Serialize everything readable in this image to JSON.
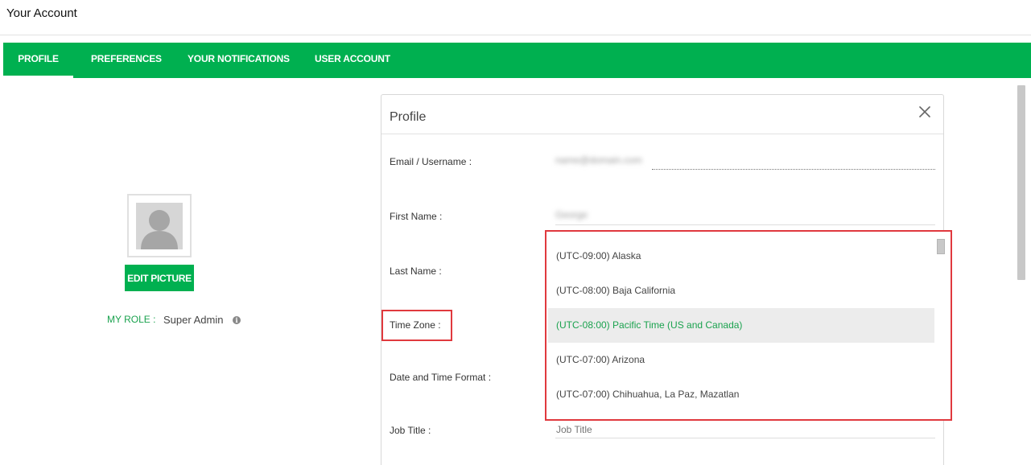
{
  "page": {
    "title": "Your Account"
  },
  "tabs": [
    {
      "label": "PROFILE",
      "active": true
    },
    {
      "label": "PREFERENCES",
      "active": false
    },
    {
      "label": "YOUR NOTIFICATIONS",
      "active": false
    },
    {
      "label": "USER ACCOUNT",
      "active": false
    }
  ],
  "sidebar": {
    "edit_picture_label": "EDIT PICTURE",
    "role_label": "MY ROLE :",
    "role_value": "Super Admin",
    "info_icon": "info-icon"
  },
  "profile": {
    "title": "Profile",
    "close_icon": "close-icon",
    "fields": {
      "email_label": "Email / Username :",
      "email_value": "name@domain.com",
      "first_name_label": "First Name :",
      "first_name_value": "George",
      "last_name_label": "Last Name :",
      "time_zone_label": "Time Zone :",
      "date_time_format_label": "Date and Time Format :",
      "job_title_label": "Job Title :",
      "job_title_placeholder": "Job Title"
    },
    "timezone_options": [
      {
        "label": "(UTC-09:00) Alaska",
        "selected": false
      },
      {
        "label": "(UTC-08:00) Baja California",
        "selected": false
      },
      {
        "label": "(UTC-08:00) Pacific Time (US and Canada)",
        "selected": true
      },
      {
        "label": "(UTC-07:00) Arizona",
        "selected": false
      },
      {
        "label": "(UTC-07:00) Chihuahua, La Paz, Mazatlan",
        "selected": false
      }
    ]
  },
  "colors": {
    "brand_green": "#00b050",
    "role_green": "#1aa24e",
    "highlight_red": "#e0393e",
    "selected_bg": "#ececec"
  }
}
